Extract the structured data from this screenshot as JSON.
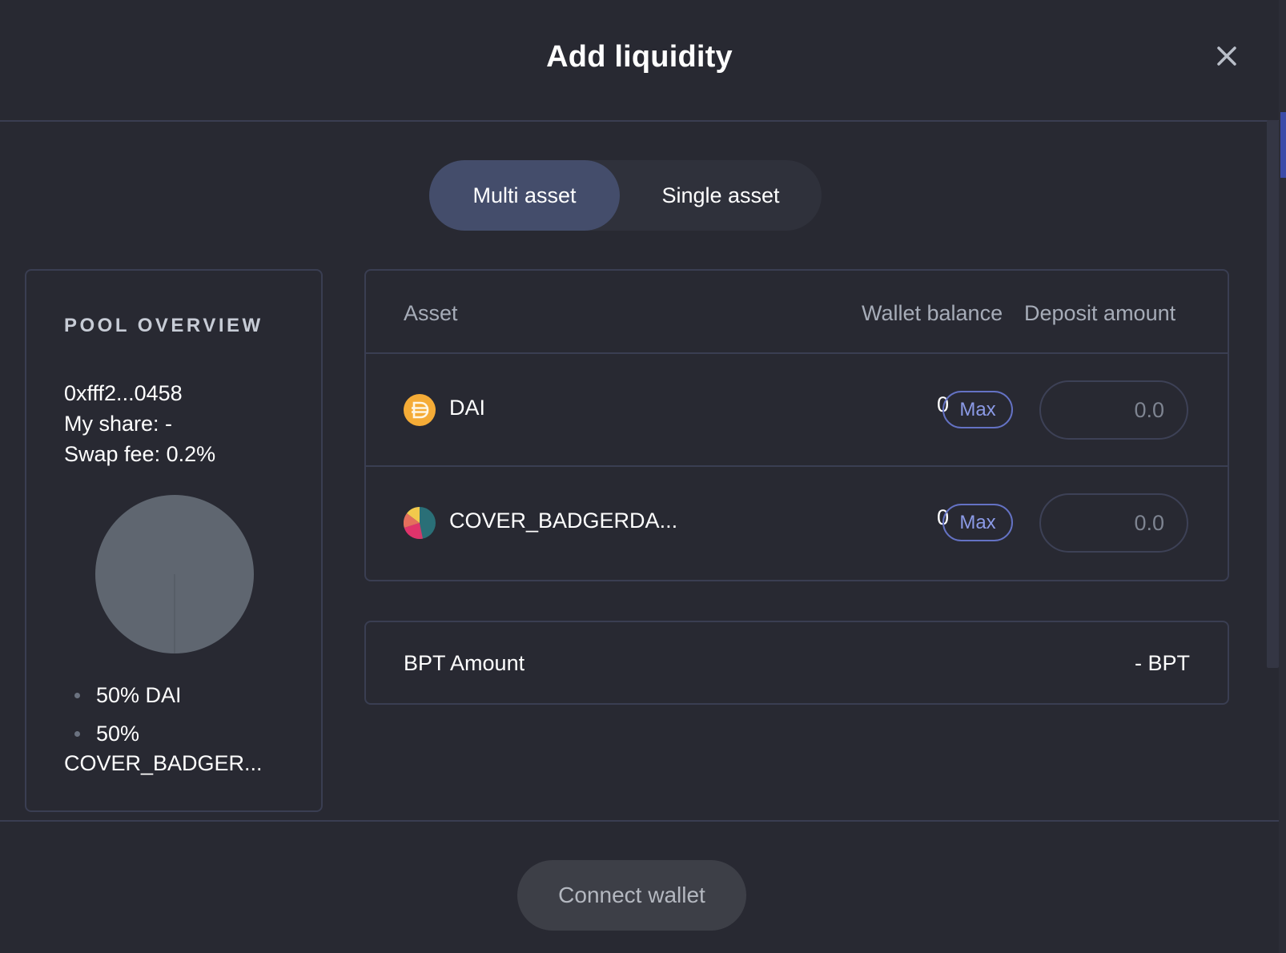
{
  "modal": {
    "title": "Add liquidity"
  },
  "tabs": [
    {
      "label": "Multi asset",
      "active": true
    },
    {
      "label": "Single asset",
      "active": false
    }
  ],
  "pool_overview": {
    "title": "POOL OVERVIEW",
    "address": "0xfff2...0458",
    "my_share": "My share: -",
    "swap_fee": "Swap fee: 0.2%",
    "pie_color": "#5f6670",
    "legend": [
      {
        "label": "50% DAI"
      },
      {
        "label": "50%",
        "label_continued": "COVER_BADGER..."
      }
    ]
  },
  "assets_table": {
    "headers": {
      "asset": "Asset",
      "wallet_balance": "Wallet balance",
      "deposit_amount": "Deposit amount"
    },
    "rows": [
      {
        "icon": "dai-token-icon",
        "name": "DAI",
        "balance": "0",
        "max_label": "Max",
        "placeholder": "0.0"
      },
      {
        "icon": "cover-badger-token-icon",
        "name": "COVER_BADGERDA...",
        "balance": "0",
        "max_label": "Max",
        "placeholder": "0.0"
      }
    ]
  },
  "bpt": {
    "label": "BPT Amount",
    "value": "- BPT"
  },
  "footer": {
    "connect_label": "Connect wallet"
  },
  "colors": {
    "background": "#282932",
    "accent": "#6472c4",
    "active_tab": "#444d6b",
    "border": "#3a3e52"
  }
}
